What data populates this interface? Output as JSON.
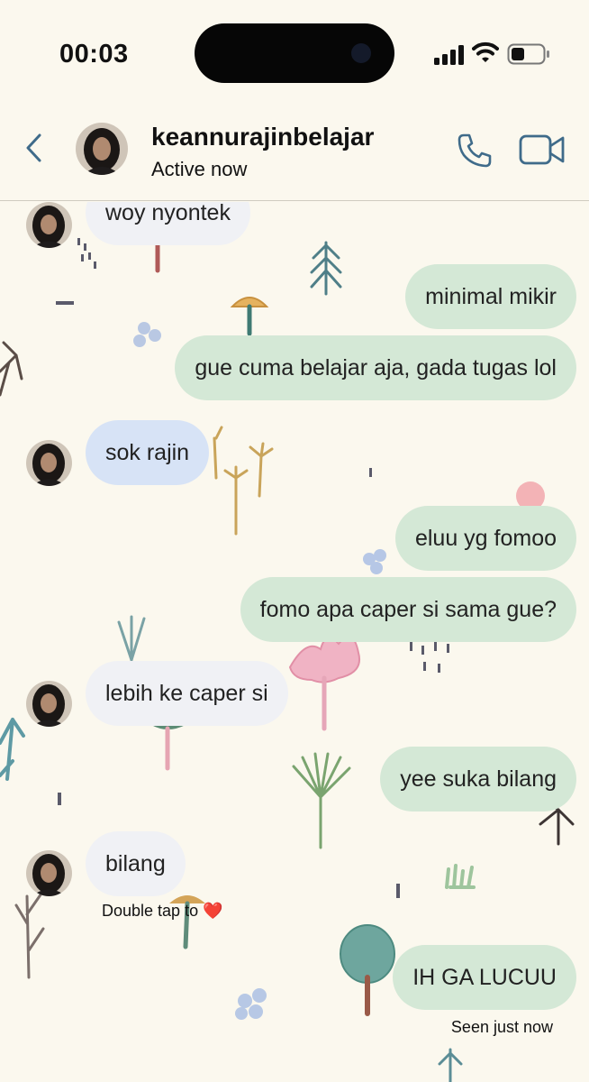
{
  "status_bar": {
    "time": "00:03",
    "icons": [
      "signal-icon",
      "wifi-icon",
      "battery-icon"
    ]
  },
  "header": {
    "username": "keannurajinbelajar",
    "presence": "Active now",
    "icons": [
      "back-icon",
      "phone-icon",
      "video-camera-icon"
    ]
  },
  "colors": {
    "background": "#fbf8ee",
    "incoming_bubble": "#f0f1f5",
    "incoming_highlight": "#d7e3f6",
    "outgoing_bubble": "#d4e8d6",
    "accent": "#3f6b8a"
  },
  "messages": [
    {
      "from": "them",
      "text": "woy nyontek"
    },
    {
      "from": "me",
      "text": "minimal mikir"
    },
    {
      "from": "me",
      "text": "gue cuma belajar aja, gada tugas lol"
    },
    {
      "from": "them",
      "text": "sok rajin"
    },
    {
      "from": "me",
      "text": "eluu yg fomoo"
    },
    {
      "from": "me",
      "text": "fomo apa caper si sama gue?"
    },
    {
      "from": "them",
      "text": "lebih ke caper si"
    },
    {
      "from": "me",
      "text": "yee suka bilang"
    },
    {
      "from": "them",
      "text": "bilang"
    },
    {
      "from": "me",
      "text": "IH GA LUCUU"
    }
  ],
  "hint": {
    "text": "Double tap to",
    "emoji": "❤️"
  },
  "seen": "Seen just now"
}
